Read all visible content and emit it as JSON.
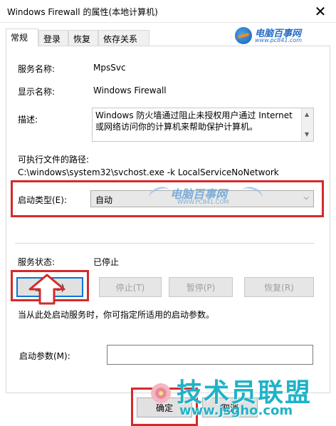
{
  "window": {
    "title": "Windows Firewall 的属性(本地计算机)",
    "close_glyph": "✕"
  },
  "tabs": [
    {
      "label": "常规",
      "active": true
    },
    {
      "label": "登录",
      "active": false
    },
    {
      "label": "恢复",
      "active": false
    },
    {
      "label": "依存关系",
      "active": false
    }
  ],
  "watermark_top": {
    "text": "电脑百事网",
    "sub": "www.pc841.com"
  },
  "general": {
    "service_name_label": "服务名称:",
    "service_name_value": "MpsSvc",
    "display_name_label": "显示名称:",
    "display_name_value": "Windows Firewall",
    "description_label": "描述:",
    "description_value": "Windows 防火墙通过阻止未授权用户通过 Internet 或网络访问你的计算机来帮助保护计算机。",
    "exe_path_label": "可执行文件的路径:",
    "exe_path_value": "C:\\windows\\system32\\svchost.exe -k LocalServiceNoNetwork",
    "startup_type_label": "启动类型(E):",
    "startup_type_value": "自动",
    "service_status_label": "服务状态:",
    "service_status_value": "已停止",
    "start_button": "启动(S)",
    "stop_button": "停止(T)",
    "pause_button": "暂停(P)",
    "resume_button": "恢复(R)",
    "hint_text": "当从此处启动服务时，你可指定所适用的启动参数。",
    "start_params_label": "启动参数(M):",
    "start_params_value": ""
  },
  "watermark_center": {
    "text": "电脑百事网",
    "sub": "WWW.PC841.COM"
  },
  "watermark_brand": {
    "text": "技术员联盟",
    "url": "www.jsgho.com"
  },
  "footer": {
    "ok_button": "确定",
    "cancel_button": "取消"
  },
  "colors": {
    "highlight_red": "#d42a2a",
    "primary_blue": "#0078d7",
    "watermark_teal": "#1fb3c8"
  }
}
